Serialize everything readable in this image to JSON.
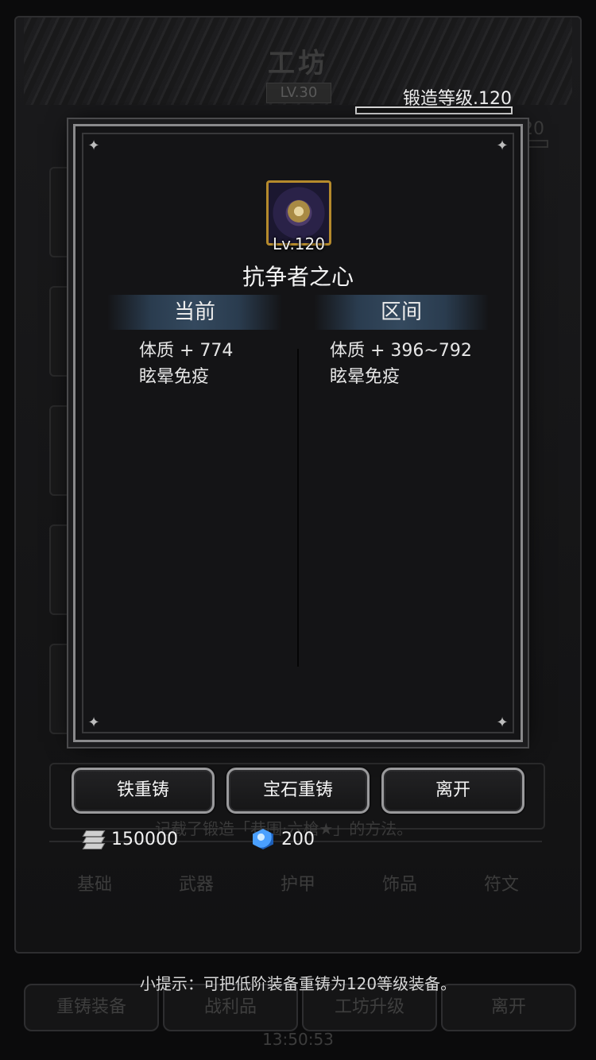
{
  "background": {
    "title": "工坊",
    "level_badge": "LV.30",
    "forge_level": "锻造等级.120",
    "forge_level_ghost": "锻造等级.120",
    "desc_text": "记载了锻造「巷围·六槍★」的方法。",
    "tabs": [
      "基础",
      "武器",
      "护甲",
      "饰品",
      "符文"
    ],
    "bottom_buttons": [
      "重铸装备",
      "战利品",
      "工坊升级",
      "离开"
    ],
    "hint": "小提示：可把低阶装备重铸为120等级装备。",
    "clock": "13:50:53"
  },
  "modal": {
    "item_level": "Lv.120",
    "item_name": "抗争者之心",
    "current_header": "当前",
    "range_header": "区间",
    "current_stats": [
      "体质 + 774",
      "眩晕免疫"
    ],
    "range_stats": [
      "体质 + 396~792",
      "眩晕免疫"
    ]
  },
  "actions": {
    "iron_reforge": "铁重铸",
    "gem_reforge": "宝石重铸",
    "leave": "离开"
  },
  "currency": {
    "iron_amount": "150000",
    "gem_amount": "200"
  },
  "colors": {
    "modal_border": "#8a8a8c",
    "header_band": "#34495e",
    "item_frame": "#b58a2c"
  }
}
